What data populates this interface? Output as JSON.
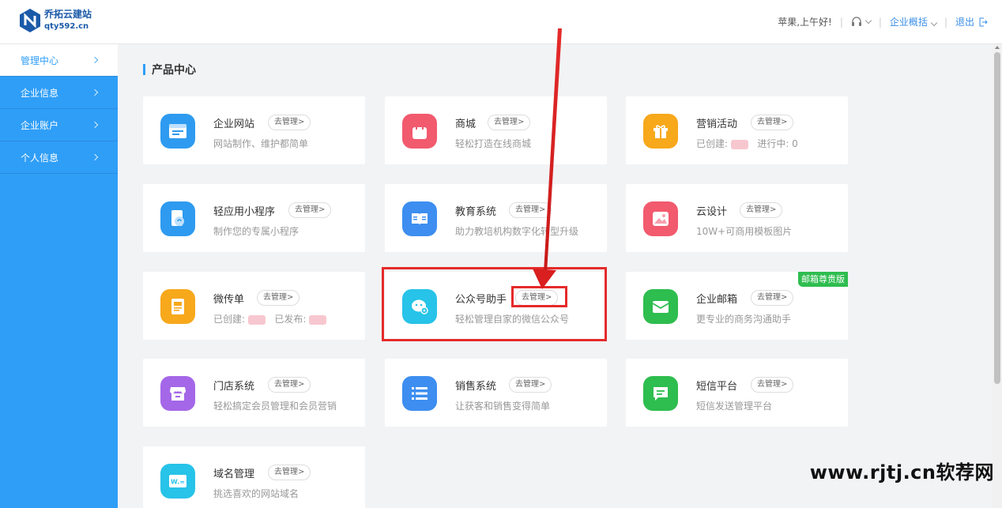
{
  "header": {
    "logo_name": "乔拓云建站",
    "logo_domain": "qty592.cn",
    "greeting": "苹果,上午好!",
    "overview": "企业概括",
    "logout": "退出"
  },
  "sidebar": {
    "items": [
      {
        "label": "管理中心"
      },
      {
        "label": "企业信息"
      },
      {
        "label": "企业账户"
      },
      {
        "label": "个人信息"
      }
    ]
  },
  "main": {
    "section_title": "产品中心",
    "manage_label": "去管理>",
    "cards": [
      {
        "title": "企业网站",
        "desc": "网站制作、维护都简单",
        "icon": "website-icon",
        "color": "#2e9bf0"
      },
      {
        "title": "商城",
        "desc": "轻松打造在线商城",
        "icon": "shop-bag-icon",
        "color": "#f25a6e"
      },
      {
        "title": "营销活动",
        "desc_created": "已创建:",
        "desc_running": "进行中: 0",
        "icon": "gift-icon",
        "color": "#f7a81b"
      },
      {
        "title": "轻应用小程序",
        "desc": "制作您的专属小程序",
        "icon": "miniapp-icon",
        "color": "#2e9bf0"
      },
      {
        "title": "教育系统",
        "desc": "助力教培机构数字化转型升级",
        "icon": "book-icon",
        "color": "#3d8ef0"
      },
      {
        "title": "云设计",
        "desc": "10W+可商用模板图片",
        "icon": "image-icon",
        "color": "#f25a6e"
      },
      {
        "title": "微传单",
        "desc_created": "已创建:",
        "desc_published": "已发布:",
        "icon": "flyer-icon",
        "color": "#f7a81b"
      },
      {
        "title": "公众号助手",
        "desc": "轻松管理自家的微信公众号",
        "icon": "wechat-icon",
        "color": "#27c3e8"
      },
      {
        "title": "企业邮箱",
        "desc": "更专业的商务沟通助手",
        "icon": "mail-icon",
        "color": "#2ebd4f",
        "badge": "邮箱尊贵版"
      },
      {
        "title": "门店系统",
        "desc": "轻松搞定会员管理和会员营销",
        "icon": "store-icon",
        "color": "#a467e8"
      },
      {
        "title": "销售系统",
        "desc": "让获客和销售变得简单",
        "icon": "list-icon",
        "color": "#3d8ef0"
      },
      {
        "title": "短信平台",
        "desc": "短信发送管理平台",
        "icon": "sms-icon",
        "color": "#2ebd4f"
      },
      {
        "title": "域名管理",
        "desc": "挑选喜欢的网站域名",
        "icon": "domain-icon",
        "color": "#27c3e8"
      }
    ]
  },
  "watermark": "www.rjtj.cn软荐网"
}
